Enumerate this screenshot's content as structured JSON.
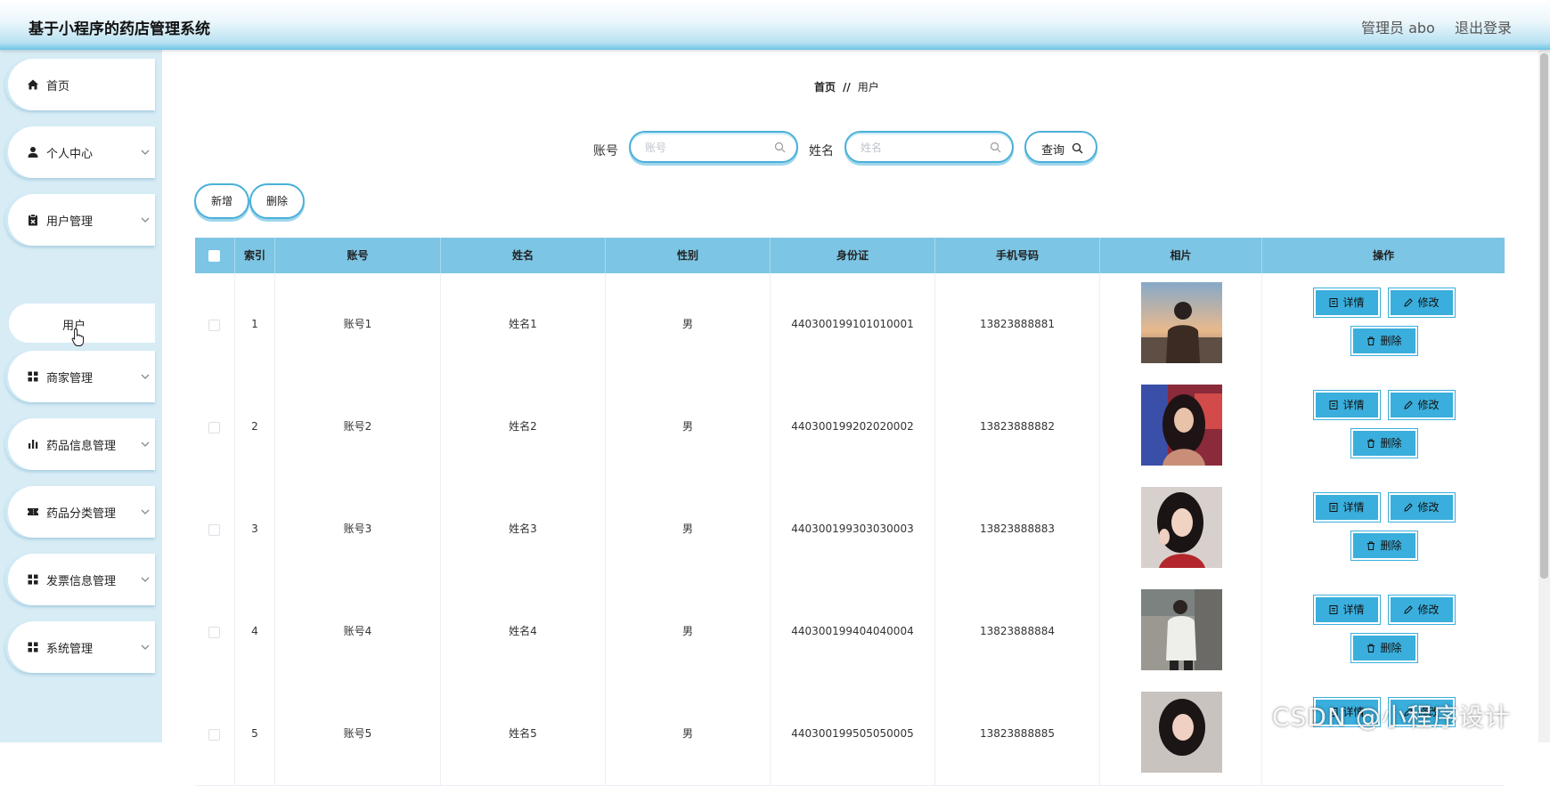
{
  "header": {
    "title": "基于小程序的药店管理系统",
    "user": "管理员 abo",
    "logout": "退出登录"
  },
  "sidebar": {
    "items": [
      {
        "label": "首页",
        "icon": "home-icon"
      },
      {
        "label": "个人中心",
        "icon": "person-icon"
      },
      {
        "label": "用户管理",
        "icon": "clipboard-icon"
      },
      {
        "label": "商家管理",
        "icon": "grid-icon"
      },
      {
        "label": "药品信息管理",
        "icon": "bar-chart-icon"
      },
      {
        "label": "药品分类管理",
        "icon": "ticket-icon"
      },
      {
        "label": "发票信息管理",
        "icon": "grid-icon"
      },
      {
        "label": "系统管理",
        "icon": "grid-icon"
      }
    ],
    "submenu": {
      "label": "用户"
    }
  },
  "breadcrumb": {
    "home": "首页",
    "sep": "//",
    "current": "用户"
  },
  "search": {
    "account_label": "账号",
    "account_placeholder": "账号",
    "account_value": "",
    "name_label": "姓名",
    "name_placeholder": "姓名",
    "name_value": "",
    "query_label": "查询"
  },
  "actions": {
    "add": "新增",
    "delete": "删除"
  },
  "table": {
    "headers": [
      "索引",
      "账号",
      "姓名",
      "性别",
      "身份证",
      "手机号码",
      "相片",
      "操作"
    ],
    "rows": [
      {
        "index": "1",
        "account": "账号1",
        "name": "姓名1",
        "gender": "男",
        "id_card": "440300199101010001",
        "phone": "13823888881"
      },
      {
        "index": "2",
        "account": "账号2",
        "name": "姓名2",
        "gender": "男",
        "id_card": "440300199202020002",
        "phone": "13823888882"
      },
      {
        "index": "3",
        "account": "账号3",
        "name": "姓名3",
        "gender": "男",
        "id_card": "440300199303030003",
        "phone": "13823888883"
      },
      {
        "index": "4",
        "account": "账号4",
        "name": "姓名4",
        "gender": "男",
        "id_card": "440300199404040004",
        "phone": "13823888884"
      },
      {
        "index": "5",
        "account": "账号5",
        "name": "姓名5",
        "gender": "男",
        "id_card": "440300199505050005",
        "phone": "13823888885"
      }
    ],
    "op_labels": {
      "detail": "详情",
      "edit": "修改",
      "delete": "删除"
    }
  },
  "watermark": "CSDN @小程序设计",
  "colors": {
    "accent": "#3aaedc",
    "table_header": "#7cc5e4",
    "sidebar_bg": "#d7ecf5"
  }
}
